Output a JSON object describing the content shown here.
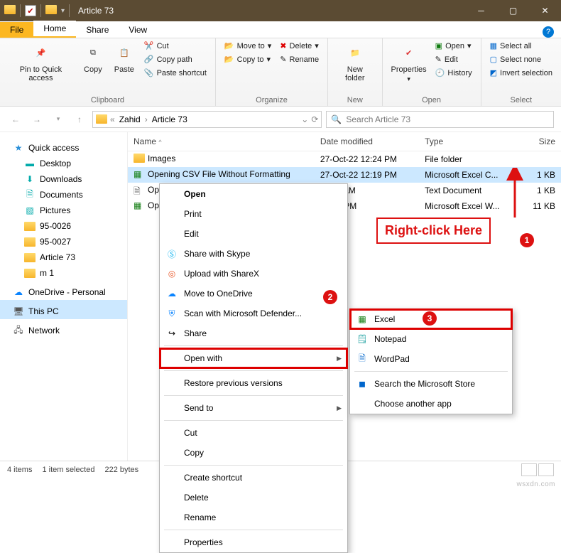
{
  "title": "Article 73",
  "tabs": {
    "file": "File",
    "home": "Home",
    "share": "Share",
    "view": "View"
  },
  "ribbon": {
    "clipboard": {
      "pin": "Pin to Quick access",
      "copy": "Copy",
      "paste": "Paste",
      "cut": "Cut",
      "copypath": "Copy path",
      "pastesc": "Paste shortcut",
      "label": "Clipboard"
    },
    "organize": {
      "moveto": "Move to",
      "copyto": "Copy to",
      "delete": "Delete",
      "rename": "Rename",
      "label": "Organize"
    },
    "new": {
      "newfolder": "New folder",
      "label": "New"
    },
    "open": {
      "properties": "Properties",
      "open": "Open",
      "edit": "Edit",
      "history": "History",
      "label": "Open"
    },
    "select": {
      "all": "Select all",
      "none": "Select none",
      "invert": "Invert selection",
      "label": "Select"
    }
  },
  "breadcrumb": {
    "seg1": "Zahid",
    "seg2": "Article 73"
  },
  "search": {
    "placeholder": "Search Article 73"
  },
  "nav": {
    "quick": "Quick access",
    "desktop": "Desktop",
    "downloads": "Downloads",
    "documents": "Documents",
    "pictures": "Pictures",
    "f1": "95-0026",
    "f2": "95-0027",
    "f3": "Article 73",
    "f4": "m 1",
    "onedrive": "OneDrive - Personal",
    "thispc": "This PC",
    "network": "Network"
  },
  "columns": {
    "name": "Name",
    "date": "Date modified",
    "type": "Type",
    "size": "Size"
  },
  "rows": [
    {
      "name": "Images",
      "date": "27-Oct-22 12:24 PM",
      "type": "File folder",
      "size": ""
    },
    {
      "name": "Opening CSV File Without Formatting",
      "date": "27-Oct-22 12:19 PM",
      "type": "Microsoft Excel C...",
      "size": "1 KB"
    },
    {
      "name": "Op",
      "date": "11:50 AM",
      "type": "Text Document",
      "size": "1 KB"
    },
    {
      "name": "Op",
      "date": "12:23 PM",
      "type": "Microsoft Excel W...",
      "size": "11 KB"
    }
  ],
  "ctx": {
    "open": "Open",
    "print": "Print",
    "edit": "Edit",
    "skype": "Share with Skype",
    "sharex": "Upload with ShareX",
    "onedrive": "Move to OneDrive",
    "defender": "Scan with Microsoft Defender...",
    "share": "Share",
    "openwith": "Open with",
    "restore": "Restore previous versions",
    "sendto": "Send to",
    "cut": "Cut",
    "copy": "Copy",
    "shortcut": "Create shortcut",
    "delete": "Delete",
    "rename": "Rename",
    "properties": "Properties"
  },
  "submenu": {
    "excel": "Excel",
    "notepad": "Notepad",
    "wordpad": "WordPad",
    "store": "Search the Microsoft Store",
    "choose": "Choose another app"
  },
  "annot": {
    "rightclick": "Right-click Here",
    "b1": "1",
    "b2": "2",
    "b3": "3"
  },
  "status": {
    "items": "4 items",
    "selected": "1 item selected",
    "bytes": "222 bytes"
  },
  "watermark": "wsxdn.com"
}
